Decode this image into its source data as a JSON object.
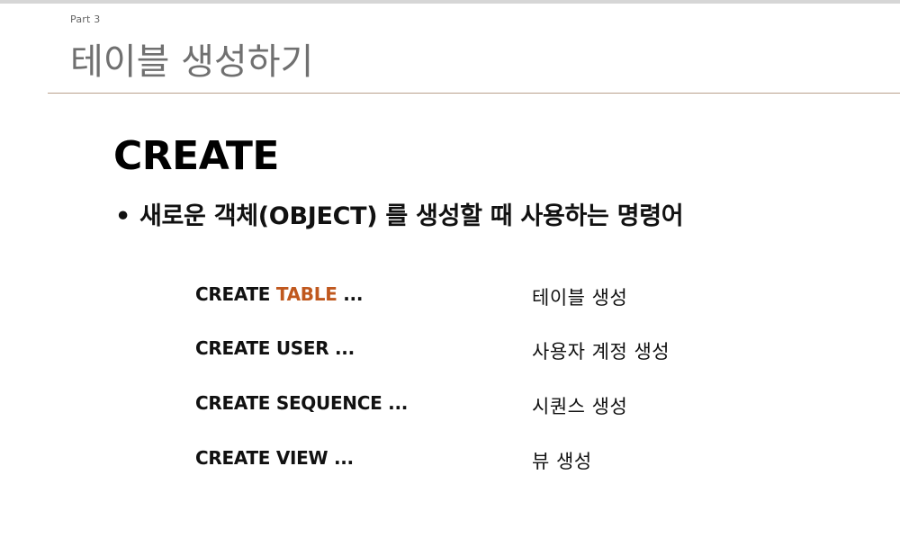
{
  "header": {
    "part_label": "Part 3",
    "title": "테이블 생성하기"
  },
  "main": {
    "heading": "CREATE",
    "bullet_dot": "•",
    "bullet_text": "새로운 객체(OBJECT) 를 생성할 때 사용하는 명령어"
  },
  "commands": [
    {
      "prefix": "CREATE ",
      "accent": "TABLE",
      "suffix": " ...",
      "description": "테이블 생성"
    },
    {
      "prefix": "CREATE USER  ...",
      "accent": "",
      "suffix": "",
      "description": "사용자 계정 생성"
    },
    {
      "prefix": "CREATE SEQUENCE  ...",
      "accent": "",
      "suffix": "",
      "description": "시퀀스 생성"
    },
    {
      "prefix": "CREATE VIEW  ...",
      "accent": "",
      "suffix": "",
      "description": "뷰 생성"
    }
  ],
  "colors": {
    "accent": "#c0581e",
    "title": "#707070",
    "rule": "#b9a08c"
  }
}
